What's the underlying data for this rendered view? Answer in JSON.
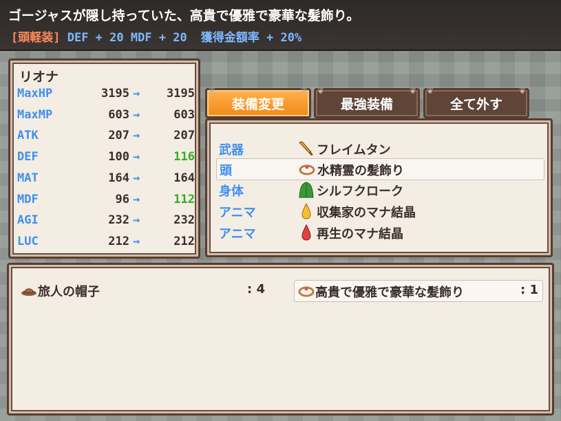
{
  "help": {
    "line1": "ゴージャスが隠し持っていた、高貴で優雅で豪華な髪飾り。",
    "category": "[頭軽装]",
    "def_bonus": "DEF + 20",
    "mdf_bonus": "MDF + 20",
    "gold_bonus": "獲得金額率 + 20%"
  },
  "status": {
    "actor_name": "リオナ",
    "arrow": "→",
    "rows": [
      {
        "label": "MaxHP",
        "old": "3195",
        "new": "3195"
      },
      {
        "label": "MaxMP",
        "old": "603",
        "new": "603"
      },
      {
        "label": "ATK",
        "old": "207",
        "new": "207"
      },
      {
        "label": "DEF",
        "old": "100",
        "new": "116"
      },
      {
        "label": "MAT",
        "old": "164",
        "new": "164"
      },
      {
        "label": "MDF",
        "old": "96",
        "new": "112"
      },
      {
        "label": "AGI",
        "old": "232",
        "new": "232"
      },
      {
        "label": "LUC",
        "old": "212",
        "new": "212"
      }
    ]
  },
  "commands": {
    "equip": "装備変更",
    "optimize": "最強装備",
    "clear": "全て外す",
    "selected": "equip"
  },
  "slots": [
    {
      "type": "武器",
      "icon": "sword-icon",
      "item": "フレイムタン"
    },
    {
      "type": "頭",
      "icon": "hair-ornament-icon",
      "item": "水精霊の髪飾り"
    },
    {
      "type": "身体",
      "icon": "green-cloak-icon",
      "item": "シルフクローク"
    },
    {
      "type": "アニマ",
      "icon": "yellow-crystal-icon",
      "item": "収集家のマナ結晶"
    },
    {
      "type": "アニマ",
      "icon": "red-crystal-icon",
      "item": "再生のマナ結晶"
    }
  ],
  "items": [
    {
      "icon": "hat-icon",
      "name": "旅人の帽子",
      "count": ": 4"
    },
    {
      "icon": "hair-ornament-icon",
      "name": "高貴で優雅で豪華な髪飾り",
      "count": ": 1"
    }
  ],
  "colors": {
    "param_label": "#3f8ff0",
    "stat_up": "#2fae20",
    "category_tag": "#ff8a5a",
    "selected_command": "#f08a1a"
  }
}
